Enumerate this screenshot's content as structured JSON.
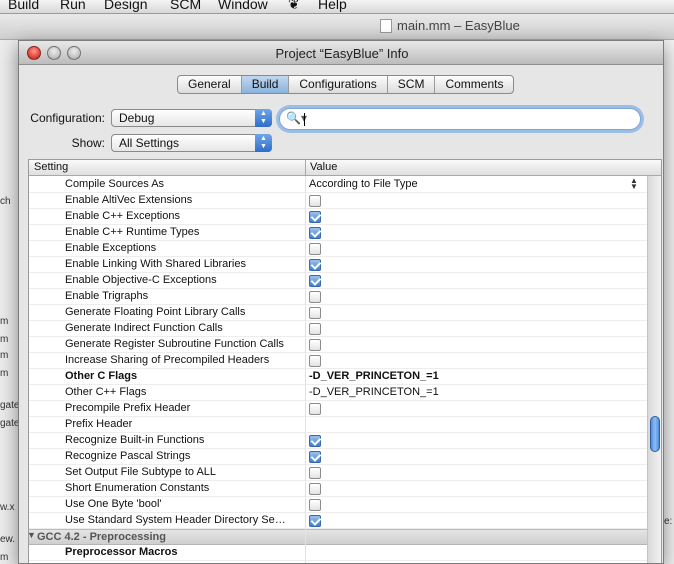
{
  "menubar": {
    "items": [
      "Build",
      "Run",
      "Design",
      "SCM",
      "Window",
      "Help"
    ]
  },
  "background_window": {
    "title": "main.mm – EasyBlue",
    "left_fragments": [
      "ch",
      "m",
      "m",
      "m",
      "m",
      "gate",
      "gate",
      "w.x",
      "ew.",
      "m"
    ],
    "right_fragment": "e:"
  },
  "window": {
    "title": "Project “EasyBlue” Info",
    "tabs": [
      {
        "label": "General",
        "active": false
      },
      {
        "label": "Build",
        "active": true
      },
      {
        "label": "Configurations",
        "active": false
      },
      {
        "label": "SCM",
        "active": false
      },
      {
        "label": "Comments",
        "active": false
      }
    ],
    "configuration_label": "Configuration:",
    "configuration_value": "Debug",
    "show_label": "Show:",
    "show_value": "All Settings",
    "search_value": "",
    "search_icon": "magnifier-with-dropdown"
  },
  "table": {
    "col_setting": "Setting",
    "col_value": "Value",
    "rows": [
      {
        "label": "Compile Sources As",
        "type": "popup",
        "value": "According to File Type"
      },
      {
        "label": "Enable AltiVec Extensions",
        "type": "checkbox",
        "checked": false
      },
      {
        "label": "Enable C++ Exceptions",
        "type": "checkbox",
        "checked": true
      },
      {
        "label": "Enable C++ Runtime Types",
        "type": "checkbox",
        "checked": true
      },
      {
        "label": "Enable Exceptions",
        "type": "checkbox",
        "checked": false
      },
      {
        "label": "Enable Linking With Shared Libraries",
        "type": "checkbox",
        "checked": true
      },
      {
        "label": "Enable Objective-C Exceptions",
        "type": "checkbox",
        "checked": true
      },
      {
        "label": "Enable Trigraphs",
        "type": "checkbox",
        "checked": false
      },
      {
        "label": "Generate Floating Point Library Calls",
        "type": "checkbox",
        "checked": false
      },
      {
        "label": "Generate Indirect Function Calls",
        "type": "checkbox",
        "checked": false
      },
      {
        "label": "Generate Register Subroutine Function Calls",
        "type": "checkbox",
        "checked": false
      },
      {
        "label": "Increase Sharing of Precompiled Headers",
        "type": "checkbox",
        "checked": false
      },
      {
        "label": "Other C Flags",
        "type": "text",
        "value": "-D_VER_PRINCETON_=1",
        "bold": true
      },
      {
        "label": "Other C++ Flags",
        "type": "text",
        "value": "-D_VER_PRINCETON_=1",
        "bold": false
      },
      {
        "label": "Precompile Prefix Header",
        "type": "checkbox",
        "checked": false
      },
      {
        "label": "Prefix Header",
        "type": "text",
        "value": "",
        "bold": false
      },
      {
        "label": "Recognize Built-in Functions",
        "type": "checkbox",
        "checked": true
      },
      {
        "label": "Recognize Pascal Strings",
        "type": "checkbox",
        "checked": true
      },
      {
        "label": "Set Output File Subtype to ALL",
        "type": "checkbox",
        "checked": false
      },
      {
        "label": "Short Enumeration Constants",
        "type": "checkbox",
        "checked": false
      },
      {
        "label": "Use One Byte 'bool'",
        "type": "checkbox",
        "checked": false
      },
      {
        "label": "Use Standard System Header Directory Se…",
        "type": "checkbox",
        "checked": true
      },
      {
        "label": "GCC 4.2 - Preprocessing",
        "type": "group"
      },
      {
        "label": "Preprocessor Macros",
        "type": "text",
        "value": "",
        "bold": true
      }
    ],
    "scroll_position": 0.68
  },
  "colors": {
    "accent_blue": "#3f7fd3",
    "close_red": "#e0443a",
    "window_bg": "#e6e6e6"
  }
}
